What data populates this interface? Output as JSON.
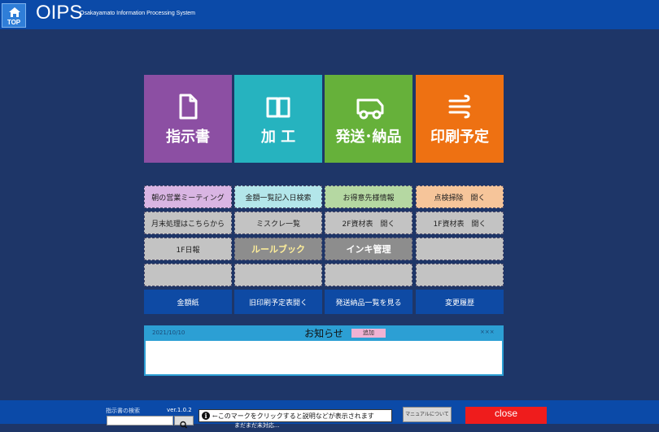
{
  "header": {
    "top_label": "TOP",
    "logo": "OIPS",
    "subtitle": "Osakayamato Information Processing System"
  },
  "tiles": [
    {
      "label": "指示書",
      "icon": "document-icon",
      "color": "#8c4fa3"
    },
    {
      "label": "加 工",
      "icon": "book-icon",
      "color": "#26b3bf"
    },
    {
      "label": "発送･納品",
      "icon": "truck-icon",
      "color": "#66b13a"
    },
    {
      "label": "印刷予定",
      "icon": "wind-icon",
      "color": "#ee7112"
    }
  ],
  "grid": {
    "row1": [
      "朝の営業ミーティング",
      "金額一覧記入日検索",
      "お得意先様情報",
      "点検掃除　開く"
    ],
    "row2": [
      "月末処理はこちらから",
      "ミスクレ一覧",
      "2F資材表　開く",
      "1F資材表　開く"
    ],
    "row3": [
      "1F日報",
      "ルールブック",
      "インキ管理",
      ""
    ],
    "row4": [
      "",
      "",
      "",
      ""
    ],
    "row5": [
      "金額紙",
      "旧印刷予定表開く",
      "発送納品一覧を見る",
      "変更履歴"
    ]
  },
  "notice": {
    "date": "2021/10/10",
    "title": "お知らせ",
    "badge": "追加",
    "mark": "×××",
    "body": ""
  },
  "footer": {
    "search_label": "指示書の検索",
    "search_value": "",
    "search_icon": "magnifier-icon",
    "version": "ver.1.0.2",
    "note": "←このマークをクリックすると説明などが表示されます",
    "note_sub": "まだまだ未対応...",
    "manual_button": "マニュアルについて",
    "close_button": "close"
  }
}
